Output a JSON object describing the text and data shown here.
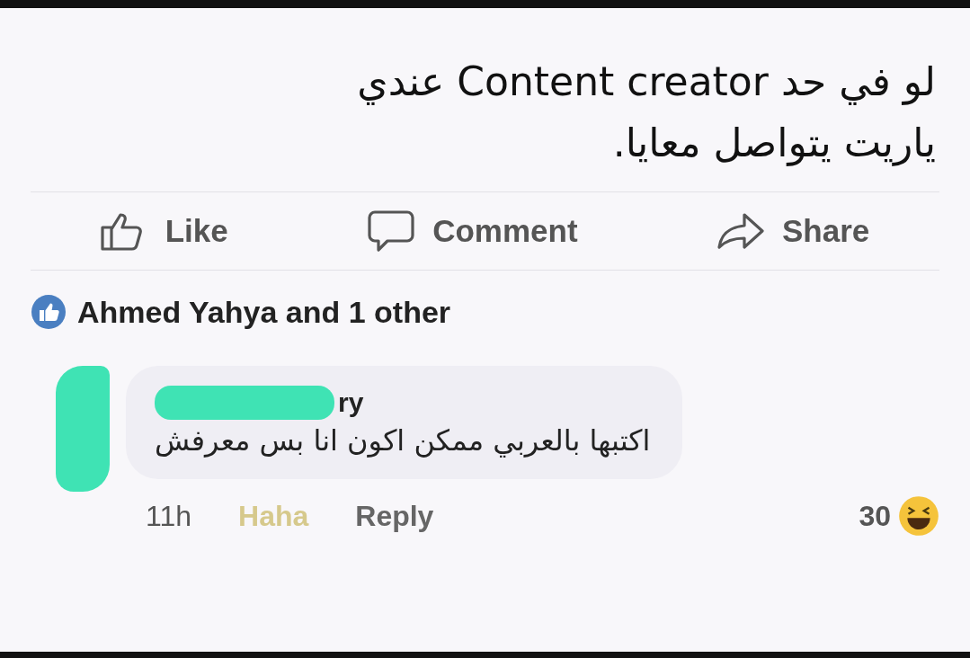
{
  "post": {
    "text": "لو في حد Content creator عندي\nياريت يتواصل معايا."
  },
  "actions": [
    {
      "kind": "like",
      "label": "Like"
    },
    {
      "kind": "comment",
      "label": "Comment"
    },
    {
      "kind": "share",
      "label": "Share"
    }
  ],
  "reactions_summary": "Ahmed Yahya and 1 other",
  "comment": {
    "author": "ry",
    "text": "اكتبها بالعربي ممكن اكون انا بس معرفش",
    "time": "11h",
    "reaction_label": "Haha",
    "reacted": true,
    "reply_label": "Reply",
    "reaction_count": "30"
  }
}
